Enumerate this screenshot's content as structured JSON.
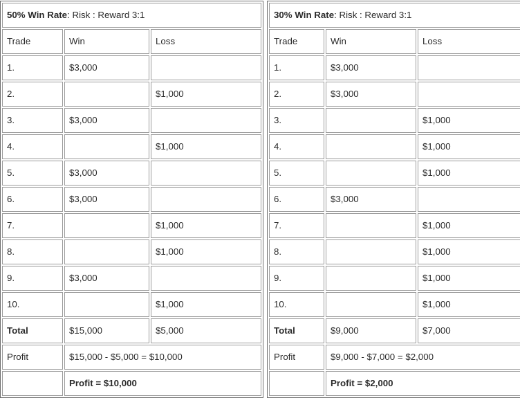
{
  "tables": [
    {
      "id": "left-table",
      "title_bold": "50% Win Rate",
      "title_rest": ": Risk : Reward 3:1",
      "columns": {
        "trade": "Trade",
        "win": "Win",
        "loss": "Loss"
      },
      "rows": [
        {
          "trade": "1.",
          "win": "$3,000",
          "loss": ""
        },
        {
          "trade": "2.",
          "win": "",
          "loss": "$1,000"
        },
        {
          "trade": "3.",
          "win": "$3,000",
          "loss": ""
        },
        {
          "trade": "4.",
          "win": "",
          "loss": "$1,000"
        },
        {
          "trade": "5.",
          "win": "$3,000",
          "loss": ""
        },
        {
          "trade": "6.",
          "win": "$3,000",
          "loss": ""
        },
        {
          "trade": "7.",
          "win": "",
          "loss": "$1,000"
        },
        {
          "trade": "8.",
          "win": "",
          "loss": "$1,000"
        },
        {
          "trade": "9.",
          "win": "$3,000",
          "loss": ""
        },
        {
          "trade": "10.",
          "win": "",
          "loss": "$1,000"
        }
      ],
      "total": {
        "label": "Total",
        "win": "$15,000",
        "loss": "$5,000"
      },
      "profit": {
        "label": "Profit",
        "formula": "$15,000 - $5,000 = $10,000"
      },
      "profit_final": {
        "label": "",
        "value": "Profit = $10,000"
      }
    },
    {
      "id": "right-table",
      "title_bold": "30% Win Rate",
      "title_rest": ": Risk : Reward 3:1",
      "columns": {
        "trade": "Trade",
        "win": "Win",
        "loss": "Loss"
      },
      "rows": [
        {
          "trade": "1.",
          "win": "$3,000",
          "loss": ""
        },
        {
          "trade": "2.",
          "win": "$3,000",
          "loss": ""
        },
        {
          "trade": "3.",
          "win": "",
          "loss": "$1,000"
        },
        {
          "trade": "4.",
          "win": "",
          "loss": "$1,000"
        },
        {
          "trade": "5.",
          "win": "",
          "loss": "$1,000"
        },
        {
          "trade": "6.",
          "win": "$3,000",
          "loss": ""
        },
        {
          "trade": "7.",
          "win": "",
          "loss": "$1,000"
        },
        {
          "trade": "8.",
          "win": "",
          "loss": "$1,000"
        },
        {
          "trade": "9.",
          "win": "",
          "loss": "$1,000"
        },
        {
          "trade": "10.",
          "win": "",
          "loss": "$1,000"
        }
      ],
      "total": {
        "label": "Total",
        "win": "$9,000",
        "loss": "$7,000"
      },
      "profit": {
        "label": "Profit",
        "formula": "$9,000 - $7,000 = $2,000"
      },
      "profit_final": {
        "label": "",
        "value": "Profit = $2,000"
      }
    }
  ],
  "colors": {
    "text": "#2b2b2b",
    "cell_border": "#9a9a9a",
    "table_border": "#6b6b6b",
    "background": "#ffffff"
  }
}
